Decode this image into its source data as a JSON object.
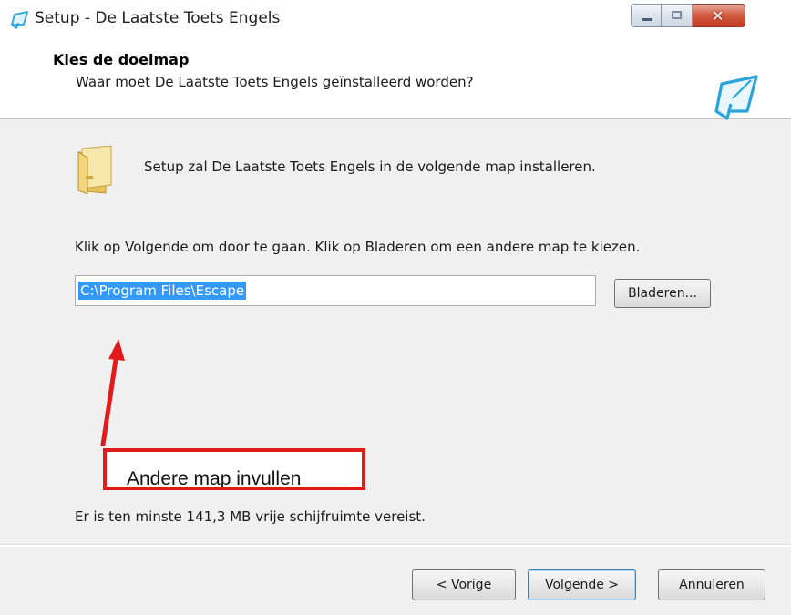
{
  "window": {
    "title": "Setup - De Laatste Toets Engels",
    "caption_buttons": {
      "minimize_icon": "minimize-icon",
      "maximize_icon": "maximize-icon",
      "close_icon": "close-icon"
    }
  },
  "header": {
    "title": "Kies de doelmap",
    "subtitle": "Waar moet De Laatste Toets Engels geïnstalleerd worden?"
  },
  "body": {
    "intro": "Setup zal De Laatste Toets Engels in de volgende map installeren.",
    "instruction": "Klik op Volgende om door te gaan. Klik op Bladeren om een andere map te kiezen.",
    "path_value": "C:\\Program Files\\Escape",
    "browse_label": "Bladeren...",
    "disk_space": "Er is ten minste 141,3 MB vrije schijfruimte vereist."
  },
  "annotation": {
    "text": "Andere map invullen",
    "color": "#e11b1b"
  },
  "footer": {
    "back_label": "< Vorige",
    "next_label": "Volgende >",
    "cancel_label": "Annuleren"
  },
  "colors": {
    "selection": "#3399ff",
    "annotation_red": "#e11b1b",
    "close_button": "#c23b22"
  }
}
